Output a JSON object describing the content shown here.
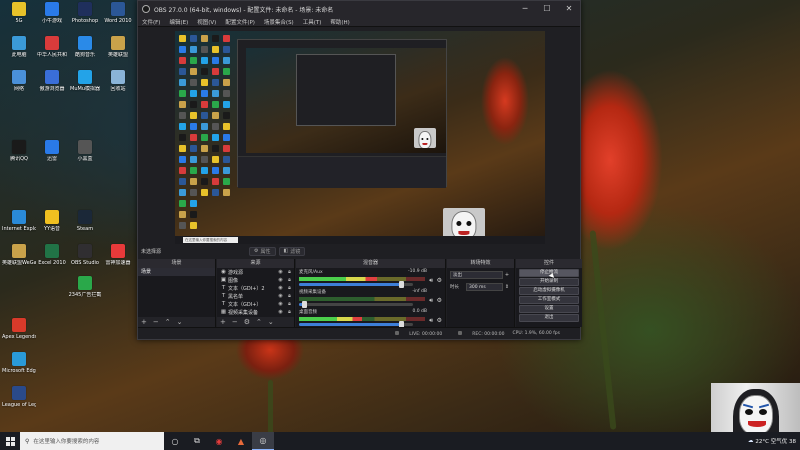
{
  "desktop": {
    "icons": [
      {
        "label": "5G",
        "color": "#e8c22a"
      },
      {
        "label": "小牛游戏",
        "color": "#2a7ae8"
      },
      {
        "label": "Photoshop",
        "color": "#1f2f5c"
      },
      {
        "label": "Word 2010",
        "color": "#2b5797"
      },
      {
        "label": "此电脑",
        "color": "#3b9ad8"
      },
      {
        "label": "中华人民共和",
        "color": "#d83b3b"
      },
      {
        "label": "酷狗音乐",
        "color": "#2a8ae8"
      },
      {
        "label": "英雄联盟",
        "color": "#c9a24a"
      },
      {
        "label": "网络",
        "color": "#4a90d9"
      },
      {
        "label": "傲游浏览器",
        "color": "#3a6ed8"
      },
      {
        "label": "MuMu模拟器",
        "color": "#23a3e8"
      },
      {
        "label": "回收站",
        "color": "#8ab4d8"
      },
      {
        "label": "腾讯QQ",
        "color": "#1a1a1a"
      },
      {
        "label": "迅雷",
        "color": "#2a7ae8"
      },
      {
        "label": "小黑盒",
        "color": "#555555"
      },
      {
        "label": "Internet Explorer",
        "color": "#2a8ad8"
      },
      {
        "label": "YY语音",
        "color": "#f0c020"
      },
      {
        "label": "Steam",
        "color": "#1b2838"
      },
      {
        "label": "英雄联盟WeGame",
        "color": "#c9a24a"
      },
      {
        "label": "Excel 2010",
        "color": "#217346"
      },
      {
        "label": "OBS Studio",
        "color": "#302e31"
      },
      {
        "label": "雷神加速器",
        "color": "#e83a3a"
      },
      {
        "label": "2345广告拦截",
        "color": "#2aa84a"
      },
      {
        "label": "Apex Legends",
        "color": "#d83a2a"
      },
      {
        "label": "Microsoft Edge",
        "color": "#2a9ad8"
      },
      {
        "label": "League of Legends",
        "color": "#2a4a8a"
      }
    ]
  },
  "obs": {
    "title": "OBS 27.0.0 (64-bit, windows) - 配置文件: 未命名 - 场景: 未命名",
    "menu": [
      "文件(F)",
      "编辑(E)",
      "视图(V)",
      "配置文件(P)",
      "场景集合(S)",
      "工具(T)",
      "帮助(H)"
    ],
    "source_toolbar": {
      "no_source": "未选择源",
      "properties": "属性",
      "filters": "滤镜"
    },
    "docks": {
      "scenes": {
        "header": "场景",
        "items": [
          "场景"
        ]
      },
      "sources": {
        "header": "来源",
        "items": [
          {
            "icon": "◉",
            "name": "游戏源"
          },
          {
            "icon": "▣",
            "name": "图像"
          },
          {
            "icon": "T",
            "name": "文本（GDI+）2"
          },
          {
            "icon": "T",
            "name": "黑名单"
          },
          {
            "icon": "T",
            "name": "文本（GDI+）"
          },
          {
            "icon": "▦",
            "name": "视频采集设备"
          }
        ]
      },
      "mixer": {
        "header": "混音器",
        "tracks": [
          {
            "name": "麦克风/Aux",
            "db": "-10.9 dB",
            "level": 0.62,
            "volume": 0.9
          },
          {
            "name": "视频采集设备",
            "db": "-inf dB",
            "level": 0.0,
            "volume": 0.05
          },
          {
            "name": "桌面音频",
            "db": "0.0 dB",
            "level": 0.5,
            "volume": 0.9
          }
        ]
      },
      "transitions": {
        "header": "转场特效",
        "effect": "淡出",
        "duration_label": "时长",
        "duration": "300 ms"
      },
      "controls": {
        "header": "控件",
        "buttons": [
          "停止推流",
          "开始录制",
          "启动虚拟摄像机",
          "工作室模式",
          "设置",
          "退出"
        ]
      }
    },
    "status": {
      "live": "LIVE: 00:00:00",
      "rec": "REC: 00:00:00",
      "cpu": "CPU: 1.9%, 60.00 fps"
    },
    "preview": {
      "inner_search": "在这里输入你要搜索的内容"
    }
  },
  "taskbar": {
    "search_placeholder": "在这里输入你要搜索的内容",
    "weather": "22°C 空气优 38"
  }
}
